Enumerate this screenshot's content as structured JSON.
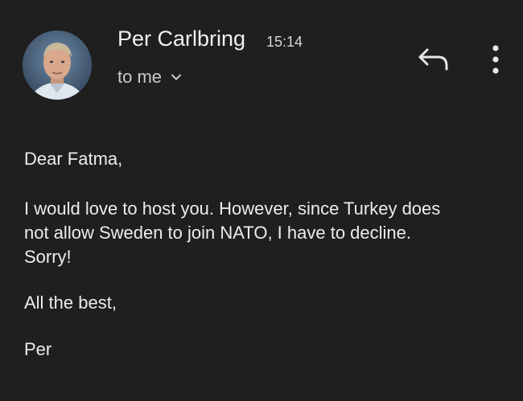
{
  "sender": {
    "name": "Per Carlbring",
    "time": "15:14"
  },
  "recipient": {
    "label": "to me"
  },
  "icons": {
    "avatar": "avatar",
    "reply": "reply-icon",
    "more": "more-vert-icon",
    "chevron": "chevron-down-icon"
  },
  "message": {
    "greeting": "Dear Fatma,",
    "line1": "I would love to host you. However, since Turkey does",
    "line2": "not allow Sweden to join NATO, I have to decline.",
    "line3": "Sorry!",
    "closing": "All the best,",
    "signature": "Per"
  },
  "colors": {
    "background": "#1f1f1f",
    "text": "#ececec",
    "secondary_text": "#c9c9c9"
  }
}
